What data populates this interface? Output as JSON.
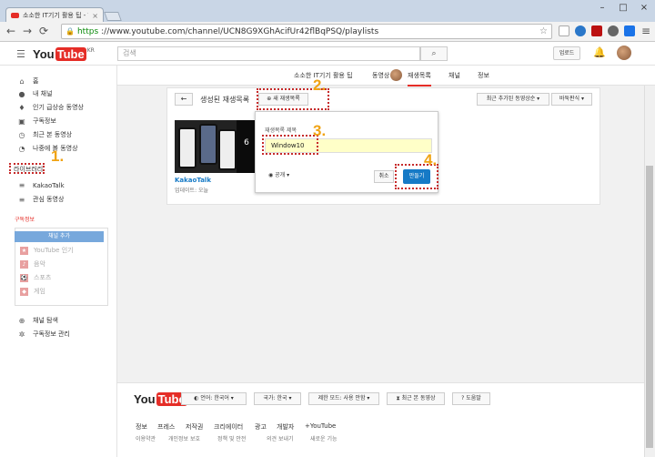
{
  "browser": {
    "tab_title": "소소한 IT기기 활용 팁 - YouTube",
    "tab_close": "×",
    "url_scheme": "https",
    "url_rest": "://www.youtube.com/channel/UCN8G9XGhAcifUr42flBqPSQ/playlists",
    "nav": {
      "back": "←",
      "forward": "→",
      "reload": "C"
    },
    "window": {
      "min": "–",
      "max": "□",
      "close": "×"
    }
  },
  "youtube": {
    "logo_you": "You",
    "logo_tube": "Tube",
    "logo_region": "KR",
    "search_placeholder": "검색",
    "upload_label": "업로드"
  },
  "sidebar": {
    "items": [
      {
        "icon": "home-icon",
        "glyph": "⌂",
        "label": "홈"
      },
      {
        "icon": "user-icon",
        "glyph": "●",
        "label": "내 채널"
      },
      {
        "icon": "flame-icon",
        "glyph": "♦",
        "label": "인기 급상승 동영상"
      },
      {
        "icon": "subscriptions-icon",
        "glyph": "▣",
        "label": "구독정보"
      },
      {
        "icon": "history-icon",
        "glyph": "◷",
        "label": "최근 본 동영상"
      },
      {
        "icon": "clock-icon",
        "glyph": "◔",
        "label": "나중에 볼 동영상"
      }
    ],
    "library_label": "라이브러리",
    "library_items": [
      {
        "icon": "playlist-icon",
        "glyph": "≡",
        "label": "KakaoTalk"
      },
      {
        "icon": "playlist-icon",
        "glyph": "≡",
        "label": "관심 동영상"
      }
    ],
    "subs_label": "구독정보",
    "add_channel": "채널 추가",
    "subs_items": [
      {
        "icon": "star-icon",
        "glyph": "★",
        "label": "YouTube 인기"
      },
      {
        "icon": "music-icon",
        "glyph": "♪",
        "label": "음악"
      },
      {
        "icon": "sports-icon",
        "glyph": "⚽",
        "label": "스포츠"
      },
      {
        "icon": "gaming-icon",
        "glyph": "◆",
        "label": "게임"
      }
    ],
    "bottom_items": [
      {
        "icon": "browse-icon",
        "glyph": "⊕",
        "label": "채널 탐색"
      },
      {
        "icon": "settings-icon",
        "glyph": "✲",
        "label": "구독정보 관리"
      }
    ]
  },
  "channel": {
    "name": "소소한 IT기기 활용 팁",
    "tabs": [
      "동영상",
      "재생목록",
      "채널",
      "정보"
    ]
  },
  "playlists": {
    "back": "←",
    "title": "생성된 재생목록",
    "new_playlist": "새 재생목록",
    "sort_added": "최근 추가된 동영상순 ▾",
    "sort_view": "바둑판식 ▾",
    "item_title": "KakaoTalk",
    "item_sub": "업데이트: 오늘",
    "thumb_count": "6"
  },
  "popup": {
    "label": "재생목록 제목",
    "input_value": "Window10",
    "privacy": "공개 ▾",
    "cancel": "취소",
    "create": "만들기"
  },
  "annotations": [
    "1.",
    "2.",
    "3.",
    "4."
  ],
  "footer": {
    "logo_you": "You",
    "logo_tube": "Tube",
    "buttons": [
      "언어: 한국어 ▾",
      "국가: 한국 ▾",
      "제한 모드: 사용 안함 ▾",
      "최근 본 동영상",
      "도움말"
    ],
    "links": [
      "정보",
      "프레스",
      "저작권",
      "크리에이터",
      "광고",
      "개발자",
      "+YouTube"
    ],
    "links2": [
      "이용약관",
      "개인정보 보호",
      "정책 및 안전",
      "의견 보내기",
      "새로운 기능"
    ]
  },
  "colors": {
    "accent": "#e52d27",
    "link": "#167ac6",
    "annotation_number": "#f0a314",
    "annotation_box": "#c62a2a"
  }
}
